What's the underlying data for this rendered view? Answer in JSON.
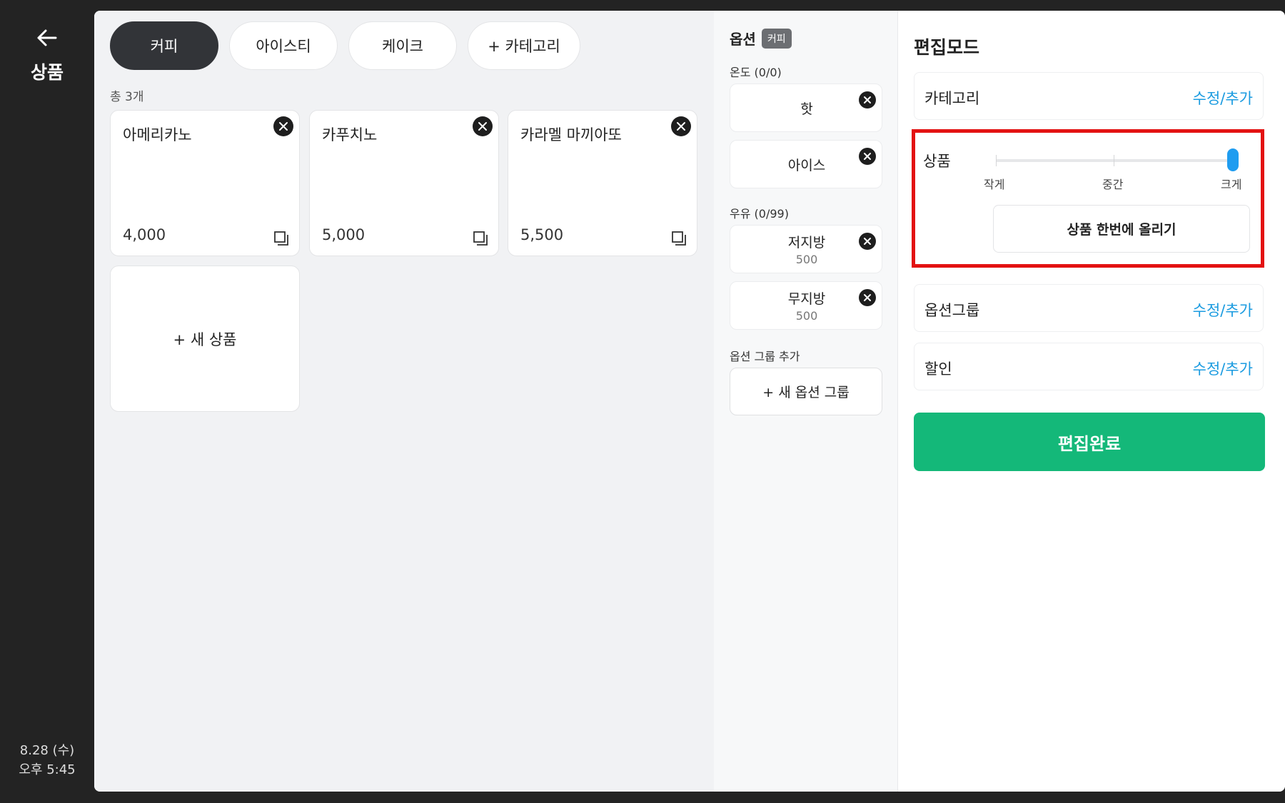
{
  "rail": {
    "page_title": "상품",
    "date": "8.28 (수)",
    "time": "오후  5:45"
  },
  "categories": [
    {
      "label": "커피",
      "active": true
    },
    {
      "label": "아이스티",
      "active": false
    },
    {
      "label": "케이크",
      "active": false
    },
    {
      "label": "+ 카테고리",
      "active": false
    }
  ],
  "product_count": "총 3개",
  "products": [
    {
      "name": "아메리카노",
      "price": "4,000"
    },
    {
      "name": "카푸치노",
      "price": "5,000"
    },
    {
      "name": "카라멜 마끼아또",
      "price": "5,500"
    }
  ],
  "new_product_label": "+ 새 상품",
  "options": {
    "header_label": "옵션",
    "category_badge": "커피",
    "groups": [
      {
        "label": "온도 (0/0)",
        "items": [
          {
            "name": "핫",
            "price": ""
          },
          {
            "name": "아이스",
            "price": ""
          }
        ]
      },
      {
        "label": "우유 (0/99)",
        "items": [
          {
            "name": "저지방",
            "price": "500"
          },
          {
            "name": "무지방",
            "price": "500"
          }
        ]
      }
    ],
    "add_group_label": "옵션 그룹 추가",
    "new_group_button": "+ 새 옵션 그룹"
  },
  "edit": {
    "title": "편집모드",
    "category_row": {
      "label": "카테고리",
      "action": "수정/추가"
    },
    "product_size": {
      "label": "상품",
      "scale_labels": [
        "작게",
        "중간",
        "크게"
      ],
      "selected": "크게",
      "bulk_button": "상품 한번에 올리기"
    },
    "option_group_row": {
      "label": "옵션그룹",
      "action": "수정/추가"
    },
    "discount_row": {
      "label": "할인",
      "action": "수정/추가"
    },
    "done_button": "편집완료"
  },
  "colors": {
    "accent_blue": "#1a9be0",
    "done_green": "#14b879",
    "highlight_red": "#e31212",
    "active_tab": "#323438"
  }
}
